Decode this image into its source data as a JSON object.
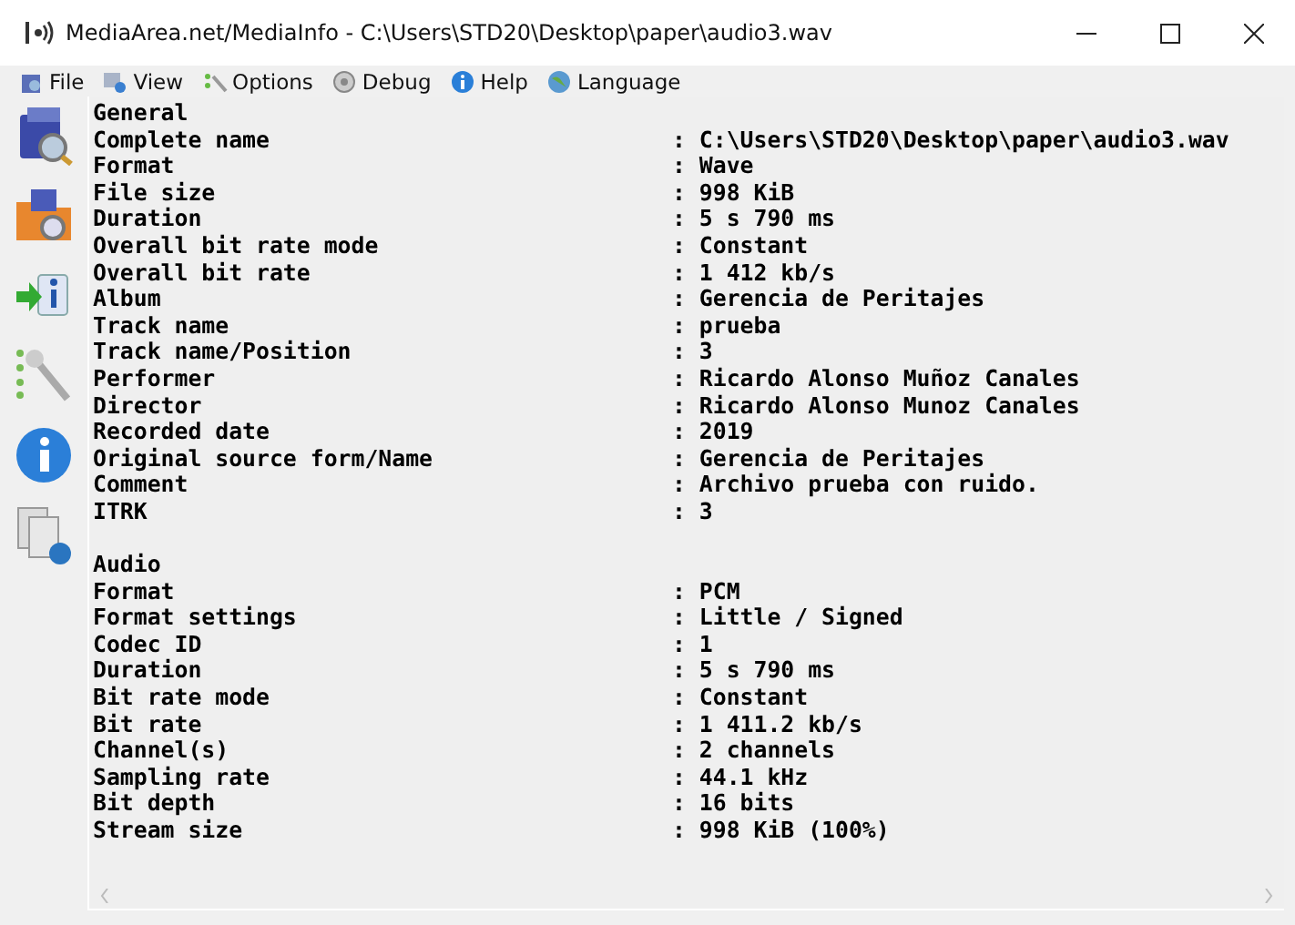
{
  "window": {
    "title": "MediaArea.net/MediaInfo - C:\\Users\\STD20\\Desktop\\paper\\audio3.wav"
  },
  "menu": [
    {
      "label": "File"
    },
    {
      "label": "View"
    },
    {
      "label": "Options"
    },
    {
      "label": "Debug"
    },
    {
      "label": "Help"
    },
    {
      "label": "Language"
    }
  ],
  "sections": [
    {
      "title": "General",
      "fields": [
        {
          "label": "Complete name",
          "value": ": C:\\Users\\STD20\\Desktop\\paper\\audio3.wav"
        },
        {
          "label": "Format",
          "value": ": Wave"
        },
        {
          "label": "File size",
          "value": ": 998 KiB"
        },
        {
          "label": "Duration",
          "value": ": 5 s 790 ms"
        },
        {
          "label": "Overall bit rate mode",
          "value": ": Constant"
        },
        {
          "label": "Overall bit rate",
          "value": ": 1 412 kb/s"
        },
        {
          "label": "Album",
          "value": ": Gerencia de Peritajes"
        },
        {
          "label": "Track name",
          "value": ": prueba"
        },
        {
          "label": "Track name/Position",
          "value": ": 3"
        },
        {
          "label": "Performer",
          "value": ": Ricardo Alonso Muñoz Canales"
        },
        {
          "label": "Director",
          "value": ": Ricardo Alonso Munoz Canales"
        },
        {
          "label": "Recorded date",
          "value": ": 2019"
        },
        {
          "label": "Original source form/Name",
          "value": ": Gerencia de Peritajes"
        },
        {
          "label": "Comment",
          "value": ": Archivo prueba con ruido."
        },
        {
          "label": "ITRK",
          "value": ": 3"
        }
      ]
    },
    {
      "title": "Audio",
      "fields": [
        {
          "label": "Format",
          "value": ": PCM"
        },
        {
          "label": "Format settings",
          "value": ": Little / Signed"
        },
        {
          "label": "Codec ID",
          "value": ": 1"
        },
        {
          "label": "Duration",
          "value": ": 5 s 790 ms"
        },
        {
          "label": "Bit rate mode",
          "value": ": Constant"
        },
        {
          "label": "Bit rate",
          "value": ": 1 411.2 kb/s"
        },
        {
          "label": "Channel(s)",
          "value": ": 2 channels"
        },
        {
          "label": "Sampling rate",
          "value": ": 44.1 kHz"
        },
        {
          "label": "Bit depth",
          "value": ": 16 bits"
        },
        {
          "label": "Stream size",
          "value": ": 998 KiB (100%)"
        }
      ]
    }
  ]
}
